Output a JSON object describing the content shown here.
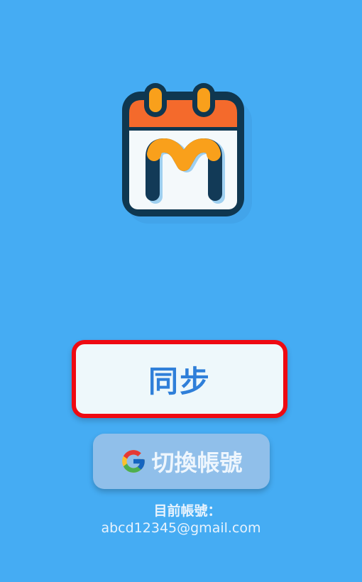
{
  "app": {
    "logo_icon": "calendar-m-logo-icon",
    "colors": {
      "background": "#45acf3",
      "logo_header": "#f46a2c",
      "logo_letter_orange": "#f9a01b",
      "logo_letter_dark": "#123a57",
      "logo_outline": "#0f3750",
      "sync_button_bg": "#eef8fb",
      "sync_button_border": "#ee0a12",
      "sync_label": "#2f7fd9",
      "switch_button_bg": "#90bfea"
    }
  },
  "actions": {
    "sync_label": "同步",
    "switch_account_icon": "google-g-icon",
    "switch_account_label": "切換帳號"
  },
  "account": {
    "caption": "目前帳號：",
    "email": "abcd12345@gmail.com"
  }
}
